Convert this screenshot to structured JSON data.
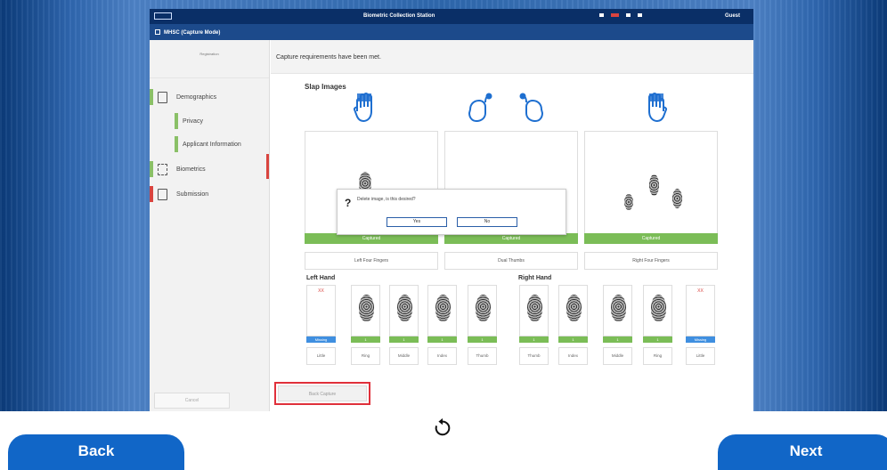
{
  "window": {
    "title": "Biometric Collection Station",
    "logo_text": "",
    "user": "Guest"
  },
  "subbar": {
    "title": "MHSC (Capture Mode)"
  },
  "sidebar": {
    "reg_lines": [
      "Registration",
      "",
      ""
    ],
    "items": [
      {
        "label": "Demographics"
      },
      {
        "label": "Privacy"
      },
      {
        "label": "Applicant Information"
      },
      {
        "label": "Biometrics"
      },
      {
        "label": "Submission"
      }
    ],
    "cancel_label": "Cancel"
  },
  "main": {
    "message": "Capture requirements have been met.",
    "slap_title": "Slap Images",
    "slaps": [
      {
        "status": "Captured",
        "button": "Left Four Fingers"
      },
      {
        "status": "Captured",
        "button": "Dual Thumbs"
      },
      {
        "status": "Captured",
        "button": "Right Four Fingers"
      }
    ],
    "left_hand_label": "Left Hand",
    "right_hand_label": "Right Hand",
    "left_fingers": [
      {
        "label": "Little",
        "status": "Missing",
        "missing": true
      },
      {
        "label": "Ring",
        "status": "1",
        "missing": false
      },
      {
        "label": "Middle",
        "status": "1",
        "missing": false
      },
      {
        "label": "Index",
        "status": "1",
        "missing": false
      },
      {
        "label": "Thumb",
        "status": "1",
        "missing": false
      }
    ],
    "right_fingers": [
      {
        "label": "Thumb",
        "status": "1",
        "missing": false
      },
      {
        "label": "Index",
        "status": "1",
        "missing": false
      },
      {
        "label": "Middle",
        "status": "1",
        "missing": false
      },
      {
        "label": "Ring",
        "status": "1",
        "missing": false
      },
      {
        "label": "Little",
        "status": "Missing",
        "missing": true
      }
    ],
    "missing_mark": "XX",
    "back_capture_label": "Back Capture"
  },
  "dialog": {
    "icon": "?",
    "message": "Delete image, is this desired?",
    "yes_label": "Yes",
    "no_label": "No"
  },
  "footer": {
    "back_label": "Back",
    "next_label": "Next",
    "refresh_icon": "refresh-icon"
  },
  "colors": {
    "primary": "#1166c7",
    "captured": "#7bbd57",
    "missing": "#3f8fe0",
    "alert": "#d9443f",
    "titlebar": "#0a2f67"
  }
}
